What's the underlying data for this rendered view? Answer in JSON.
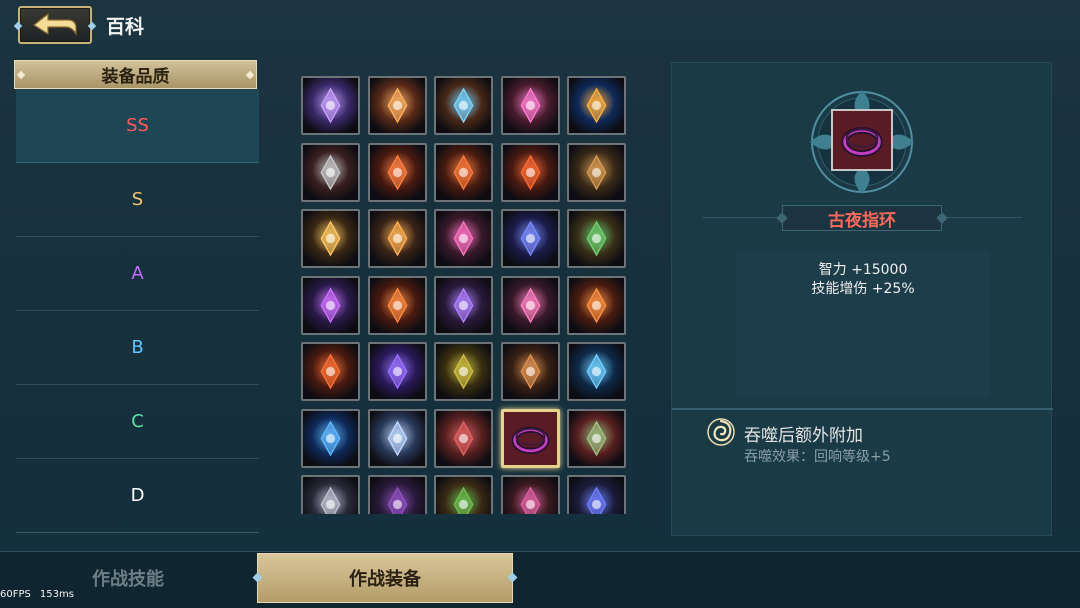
{
  "header": {
    "title": "百科",
    "back_icon": "back-arrow-icon"
  },
  "categories": {
    "title": "装备品质",
    "items": [
      {
        "label": "SS",
        "color": "#ff5a5a",
        "active": true
      },
      {
        "label": "S",
        "color": "#f5c56a",
        "active": false
      },
      {
        "label": "A",
        "color": "#c66bff",
        "active": false
      },
      {
        "label": "B",
        "color": "#5fc6ff",
        "active": false
      },
      {
        "label": "C",
        "color": "#5fe0a6",
        "active": false
      },
      {
        "label": "D",
        "color": "#ffffff",
        "active": false
      }
    ]
  },
  "grid": {
    "items": [
      {
        "icon": "crystal-cluster-icon",
        "bg": "#3a2a6a",
        "fg": "#c9a0ff"
      },
      {
        "icon": "sun-compass-icon",
        "bg": "#5a2a18",
        "fg": "#ffb060"
      },
      {
        "icon": "gem-crossbow-icon",
        "bg": "#4a2818",
        "fg": "#7ad6ff"
      },
      {
        "icon": "pink-crystal-icon",
        "bg": "#4a1c2c",
        "fg": "#ff7ad0"
      },
      {
        "icon": "golden-ring-icon",
        "bg": "#0e2a5a",
        "fg": "#ffb040"
      },
      {
        "icon": "steel-armor-icon",
        "bg": "#3a2020",
        "fg": "#c8c8c8"
      },
      {
        "icon": "fire-axe-icon",
        "bg": "#4a1a10",
        "fg": "#ff8040"
      },
      {
        "icon": "flame-bow-icon",
        "bg": "#4a1c10",
        "fg": "#ff7a3a"
      },
      {
        "icon": "flame-shield-icon",
        "bg": "#4a1a12",
        "fg": "#ff6a30"
      },
      {
        "icon": "bronze-blade-icon",
        "bg": "#3a2a18",
        "fg": "#d89a50"
      },
      {
        "icon": "golden-spear-icon",
        "bg": "#3a2814",
        "fg": "#ffc860"
      },
      {
        "icon": "golden-scepter-icon",
        "bg": "#3a2418",
        "fg": "#ffb050"
      },
      {
        "icon": "pink-star-staff-icon",
        "bg": "#3a1a2a",
        "fg": "#ff70c0"
      },
      {
        "icon": "purple-boots-icon",
        "bg": "#1a1c4a",
        "fg": "#7a8aff"
      },
      {
        "icon": "green-hammer-icon",
        "bg": "#3a3018",
        "fg": "#70d070"
      },
      {
        "icon": "purple-tome-icon",
        "bg": "#2a1a4a",
        "fg": "#d070ff"
      },
      {
        "icon": "flame-sword-icon",
        "bg": "#4a1a10",
        "fg": "#ff8a40"
      },
      {
        "icon": "purple-axe-icon",
        "bg": "#2a1a3a",
        "fg": "#b080ff"
      },
      {
        "icon": "rose-scepter-icon",
        "bg": "#3a1a2a",
        "fg": "#ff80c0"
      },
      {
        "icon": "flame-dagger-icon",
        "bg": "#4a1c10",
        "fg": "#ff9040"
      },
      {
        "icon": "fire-claw-icon",
        "bg": "#4a1a10",
        "fg": "#ff7030"
      },
      {
        "icon": "violet-scroll-icon",
        "bg": "#2a1a5a",
        "fg": "#9a70ff"
      },
      {
        "icon": "emerald-ring-icon",
        "bg": "#3a3010",
        "fg": "#d0c040"
      },
      {
        "icon": "rune-book-icon",
        "bg": "#3a2014",
        "fg": "#e09050"
      },
      {
        "icon": "frost-blade-icon",
        "bg": "#0e2a4a",
        "fg": "#70d0ff"
      },
      {
        "icon": "ice-spirit-icon",
        "bg": "#0e2a5a",
        "fg": "#60b8ff"
      },
      {
        "icon": "ice-spikes-icon",
        "bg": "#2a3a5a",
        "fg": "#c0d8ff"
      },
      {
        "icon": "red-arrow-icon",
        "bg": "#5a2020",
        "fg": "#e06060"
      },
      {
        "icon": "night-ring-icon",
        "bg": "#5a1c24",
        "fg": "#c040c0"
      },
      {
        "icon": "green-halberd-icon",
        "bg": "#5a2020",
        "fg": "#a0c080"
      },
      {
        "icon": "silver-fan-icon",
        "bg": "#2a2a3a",
        "fg": "#c0c0d0"
      },
      {
        "icon": "violet-robe-icon",
        "bg": "#2a1a3a",
        "fg": "#9050c0"
      },
      {
        "icon": "leaf-armor-icon",
        "bg": "#3a2a14",
        "fg": "#70c050"
      },
      {
        "icon": "crimson-staff-icon",
        "bg": "#3a1a20",
        "fg": "#e060a0"
      },
      {
        "icon": "blue-scythe-icon",
        "bg": "#1a1c3a",
        "fg": "#7080ff"
      }
    ],
    "selected_index": 28
  },
  "detail": {
    "item_icon": "night-ring-icon",
    "name": "古夜指环",
    "name_color": "#ff6a5e",
    "stats": [
      "智力 +15000",
      "技能增伤 +25%"
    ],
    "devour_icon": "swirl-icon",
    "devour_title": "吞噬后额外附加",
    "devour_effect": "吞噬效果：回响等级+5"
  },
  "tabs": {
    "skills": "作战技能",
    "equipment": "作战装备",
    "active": "equipment"
  },
  "fps": {
    "fps": "60FPS",
    "ms": "153ms"
  }
}
